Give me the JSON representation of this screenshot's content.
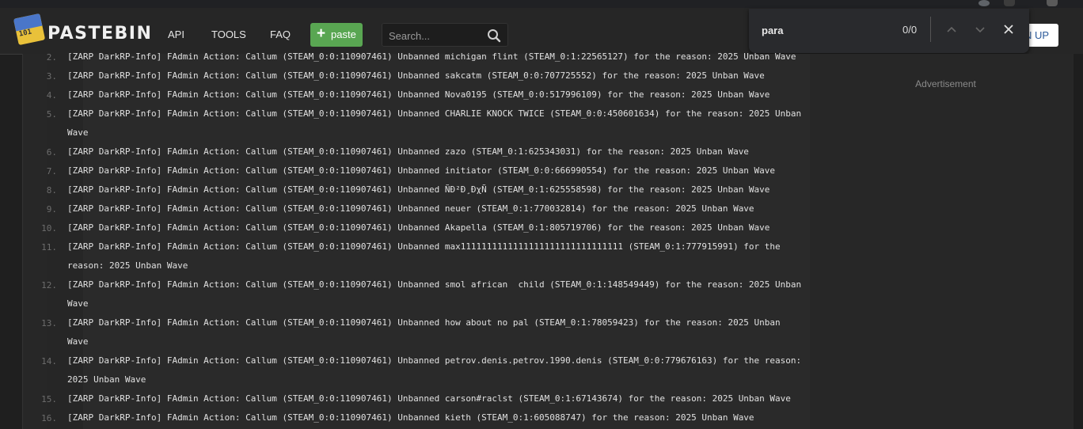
{
  "header": {
    "logo_text": "PASTEBIN",
    "logo_badge": "101",
    "nav": [
      "API",
      "TOOLS",
      "FAQ"
    ],
    "paste_label": "paste",
    "search_placeholder": "Search...",
    "signup_partial": "N UP"
  },
  "find_bar": {
    "query": "para",
    "count": "0/0"
  },
  "sidebar": {
    "ad_label": "Advertisement"
  },
  "lines": [
    {
      "num": "2.",
      "text": "[ZARP DarkRP-Info] FAdmin Action: Callum (STEAM_0:0:110907461) Unbanned michigan flint (STEAM_0:1:22565127) for the reason: 2025 Unban Wave"
    },
    {
      "num": "3.",
      "text": "[ZARP DarkRP-Info] FAdmin Action: Callum (STEAM_0:0:110907461) Unbanned sakcatm (STEAM_0:0:707725552) for the reason: 2025 Unban Wave"
    },
    {
      "num": "4.",
      "text": "[ZARP DarkRP-Info] FAdmin Action: Callum (STEAM_0:0:110907461) Unbanned Nova0195 (STEAM_0:0:517996109) for the reason: 2025 Unban Wave"
    },
    {
      "num": "5.",
      "text": "[ZARP DarkRP-Info] FAdmin Action: Callum (STEAM_0:0:110907461) Unbanned CHARLIE KNOCK TWICE (STEAM_0:0:450601634) for the reason: 2025 Unban",
      "cont": "Wave"
    },
    {
      "num": "6.",
      "text": "[ZARP DarkRP-Info] FAdmin Action: Callum (STEAM_0:0:110907461) Unbanned zazo (STEAM_0:1:625343031) for the reason: 2025 Unban Wave"
    },
    {
      "num": "7.",
      "text": "[ZARP DarkRP-Info] FAdmin Action: Callum (STEAM_0:0:110907461) Unbanned initiator (STEAM_0:0:666990554) for the reason: 2025 Unban Wave"
    },
    {
      "num": "8.",
      "text": "[ZARP DarkRP-Info] FAdmin Action: Callum (STEAM_0:0:110907461) Unbanned ÑÐ²Ð¸ÐχÑ (STEAM_0:1:625558598) for the reason: 2025 Unban Wave"
    },
    {
      "num": "9.",
      "text": "[ZARP DarkRP-Info] FAdmin Action: Callum (STEAM_0:0:110907461) Unbanned neuer (STEAM_0:1:770032814) for the reason: 2025 Unban Wave"
    },
    {
      "num": "10.",
      "text": "[ZARP DarkRP-Info] FAdmin Action: Callum (STEAM_0:0:110907461) Unbanned Akapella (STEAM_0:1:805719706) for the reason: 2025 Unban Wave"
    },
    {
      "num": "11.",
      "text": "[ZARP DarkRP-Info] FAdmin Action: Callum (STEAM_0:0:110907461) Unbanned max1111111111111111111111111111111 (STEAM_0:1:777915991) for the",
      "cont": "reason: 2025 Unban Wave"
    },
    {
      "num": "12.",
      "text": "[ZARP DarkRP-Info] FAdmin Action: Callum (STEAM_0:0:110907461) Unbanned smol african  child (STEAM_0:1:148549449) for the reason: 2025 Unban",
      "cont": "Wave"
    },
    {
      "num": "13.",
      "text": "[ZARP DarkRP-Info] FAdmin Action: Callum (STEAM_0:0:110907461) Unbanned how about no pal (STEAM_0:1:78059423) for the reason: 2025 Unban",
      "cont": "Wave"
    },
    {
      "num": "14.",
      "text": "[ZARP DarkRP-Info] FAdmin Action: Callum (STEAM_0:0:110907461) Unbanned petrov.denis.petrov.1990.denis (STEAM_0:0:779676163) for the reason:",
      "cont": "2025 Unban Wave"
    },
    {
      "num": "15.",
      "text": "[ZARP DarkRP-Info] FAdmin Action: Callum (STEAM_0:0:110907461) Unbanned carson#raclst (STEAM_0:1:67143674) for the reason: 2025 Unban Wave"
    },
    {
      "num": "16.",
      "text": "[ZARP DarkRP-Info] FAdmin Action: Callum (STEAM_0:0:110907461) Unbanned kieth (STEAM_0:1:605088747) for the reason: 2025 Unban Wave"
    }
  ]
}
